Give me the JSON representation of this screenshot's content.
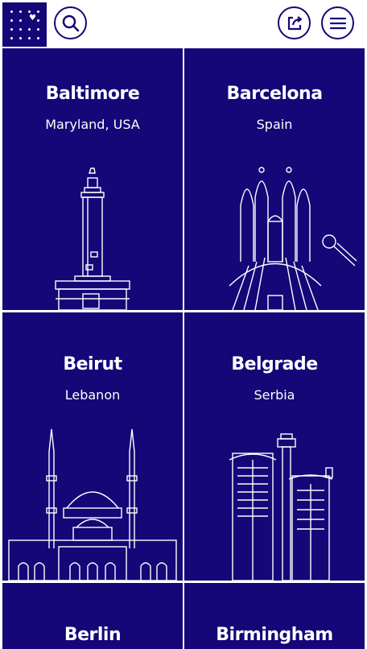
{
  "header": {
    "logo_icon": "dotted-grid-heart-logo",
    "search_icon": "search-icon",
    "share_icon": "share-icon",
    "menu_icon": "hamburger-menu-icon"
  },
  "colors": {
    "brand": "#150778",
    "text_on_brand": "#ffffff",
    "background": "#ffffff"
  },
  "cities": [
    {
      "name": "Baltimore",
      "region": "Maryland, USA"
    },
    {
      "name": "Barcelona",
      "region": "Spain"
    },
    {
      "name": "Beirut",
      "region": "Lebanon"
    },
    {
      "name": "Belgrade",
      "region": "Serbia"
    },
    {
      "name": "Berlin",
      "region": ""
    },
    {
      "name": "Birmingham",
      "region": ""
    }
  ]
}
